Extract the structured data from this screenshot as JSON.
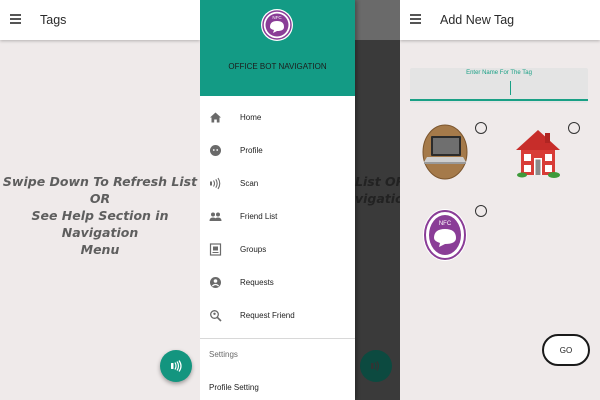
{
  "screen1": {
    "title": "Tags",
    "empty_message_line1": "Swipe Down To Refresh List OR",
    "empty_message_line2": "See Help Section in Navigation",
    "empty_message_line3": "Menu",
    "fab_icon": "nfc-scan-icon"
  },
  "screen2": {
    "behind_line1": "List OR",
    "behind_line2": "vigation",
    "drawer": {
      "logo_text": "NFC",
      "title": "OFFICE BOT NAVIGATION",
      "items": [
        {
          "label": "Home",
          "icon": "home-icon"
        },
        {
          "label": "Profile",
          "icon": "profile-icon"
        },
        {
          "label": "Scan",
          "icon": "nfc-icon"
        },
        {
          "label": "Friend List",
          "icon": "people-icon"
        },
        {
          "label": "Groups",
          "icon": "group-icon"
        },
        {
          "label": "Requests",
          "icon": "account-icon"
        },
        {
          "label": "Request Friend",
          "icon": "person-search-icon"
        }
      ],
      "section_label": "Settings",
      "profile_setting": "Profile Setting"
    }
  },
  "screen3": {
    "title": "Add New Tag",
    "name_field_placeholder": "Enter Name For The Tag",
    "tag_options": [
      {
        "icon": "laptop-icon"
      },
      {
        "icon": "house-icon"
      },
      {
        "icon": "nfc-logo-icon",
        "logo_text": "NFC"
      }
    ],
    "go_label": "GO"
  },
  "colors": {
    "accent": "#139b85",
    "background": "#efeaea",
    "nfc_purple": "#8a3d97"
  }
}
